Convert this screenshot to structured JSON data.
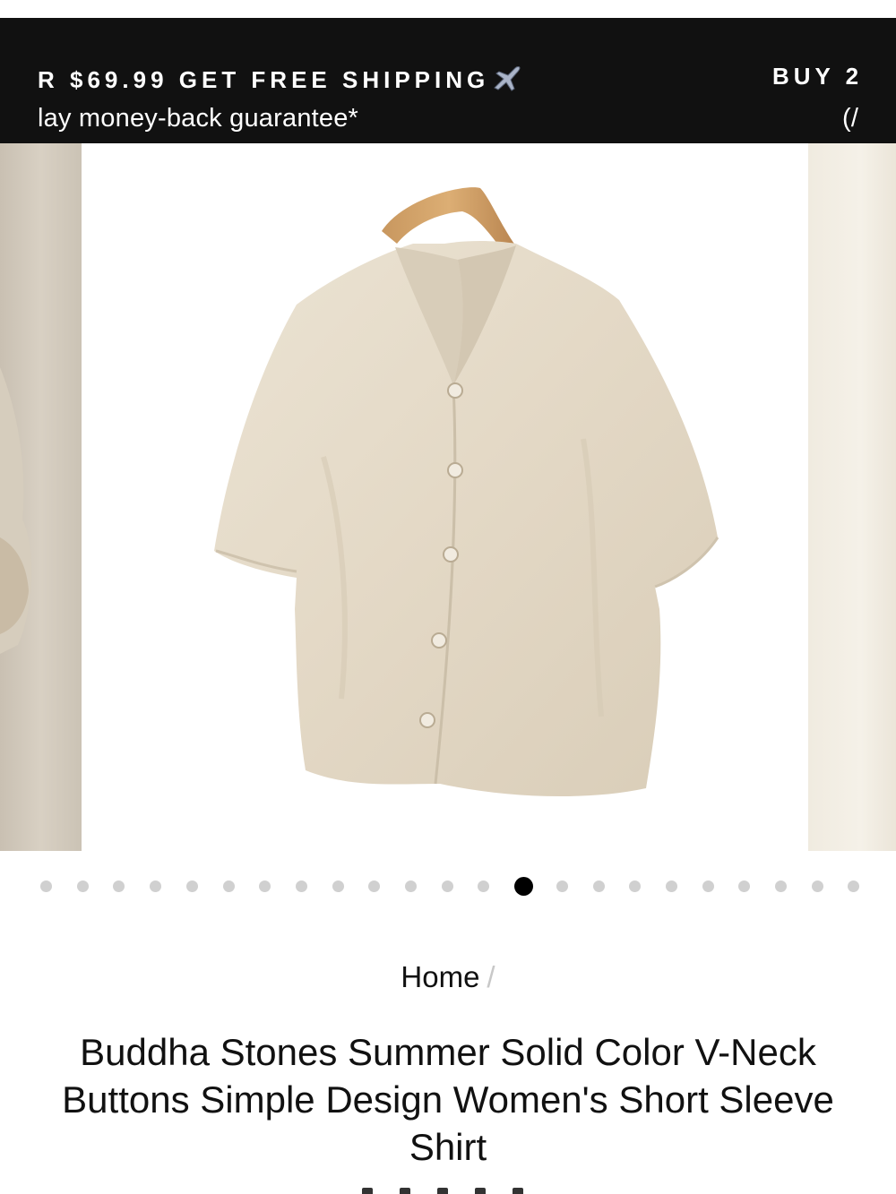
{
  "announcement": {
    "promo_left": "R $69.99 GET FREE SHIPPING",
    "promo_right": "BUY 2",
    "guarantee_left": "lay money-back guarantee*",
    "guarantee_right": "(/"
  },
  "gallery": {
    "image_alt": "Buddha Stones Summer Solid Color V-Neck Buttons Simple Design Women's Short Sleeve Shirt",
    "dot_count": 23,
    "active_index": 13
  },
  "breadcrumb": {
    "home": "Home",
    "separator": "/"
  },
  "product": {
    "title": "Buddha Stones Summer Solid Color V-Neck Buttons Simple Design Women's Short Sleeve Shirt"
  },
  "icons": [
    "plane-icon",
    "star-icon"
  ],
  "colors": {
    "banner_bg": "#111111",
    "shirt": "#e6dccb",
    "dot_inactive": "#d0d0d0",
    "dot_active": "#000000"
  }
}
